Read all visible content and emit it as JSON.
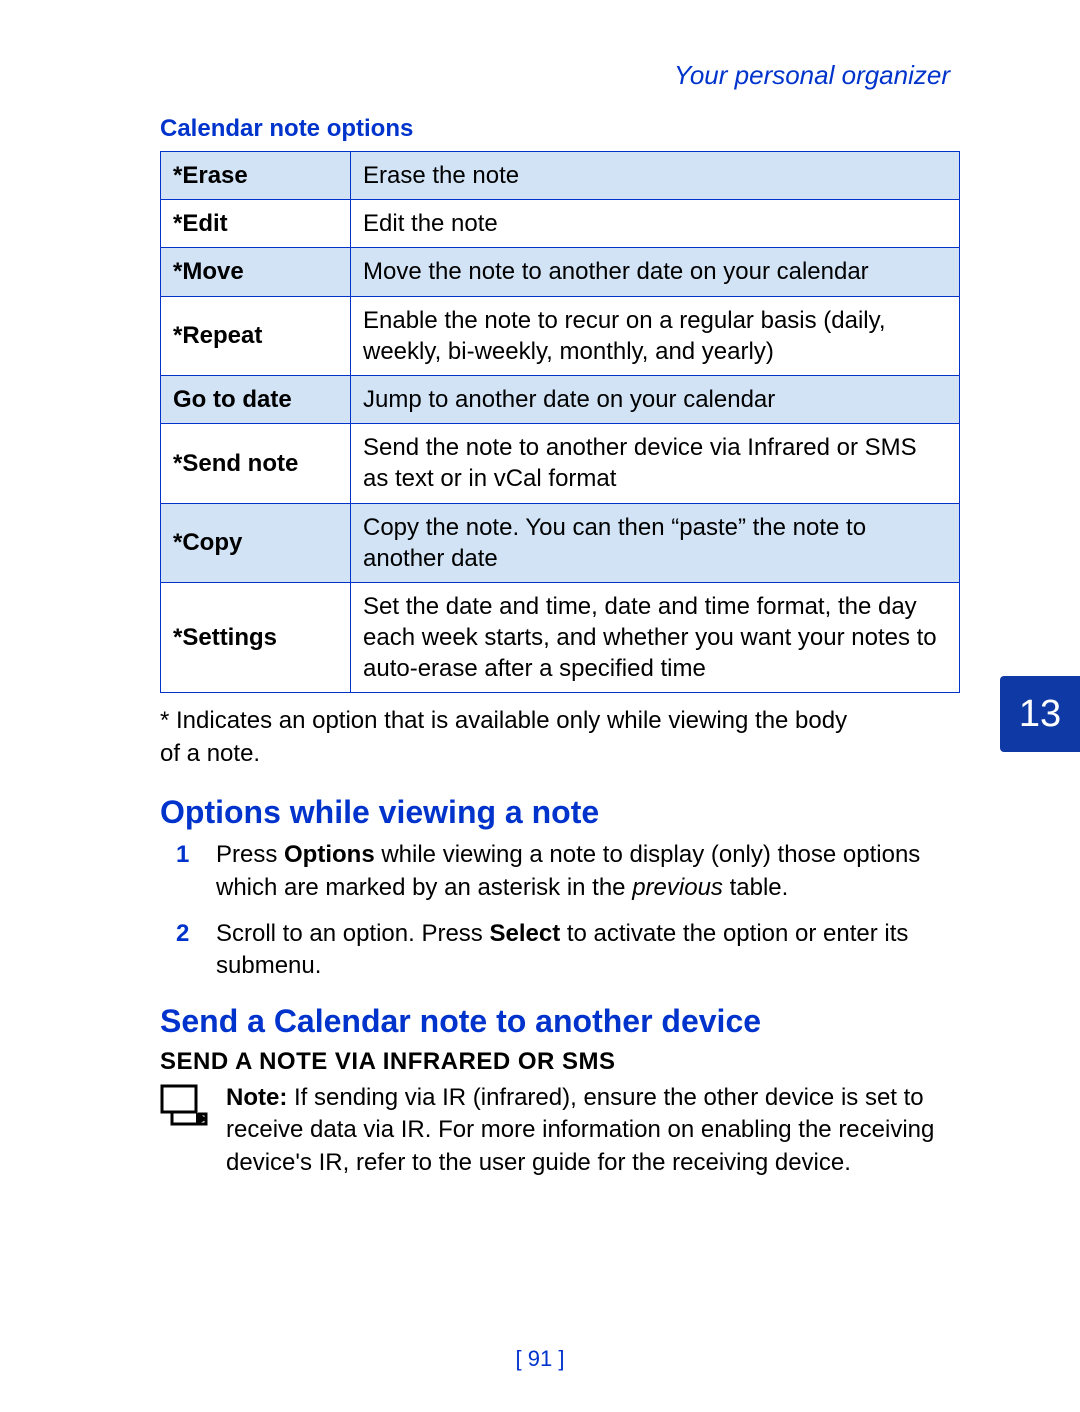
{
  "header": {
    "category": "Your personal organizer"
  },
  "section_caption": "Calendar note options",
  "table": {
    "rows": [
      {
        "option": "*Erase",
        "desc": "Erase the note",
        "shaded": true
      },
      {
        "option": "*Edit",
        "desc": "Edit the note",
        "shaded": false
      },
      {
        "option": "*Move",
        "desc": "Move the note to another date on your calendar",
        "shaded": true
      },
      {
        "option": "*Repeat",
        "desc": "Enable the note to recur on a regular basis (daily, weekly, bi-weekly, monthly, and yearly)",
        "shaded": false
      },
      {
        "option": "Go to date",
        "desc": "Jump to another date on your calendar",
        "shaded": true
      },
      {
        "option": "*Send note",
        "desc": "Send the note to another device via Infrared or SMS as text or in vCal format",
        "shaded": false
      },
      {
        "option": "*Copy",
        "desc": "Copy the note. You can then “paste” the note to another date",
        "shaded": true
      },
      {
        "option": "*Settings",
        "desc": "Set the date and time, date and time format, the day each week starts, and whether you want your notes to auto-erase after a specified time",
        "shaded": false
      }
    ]
  },
  "footnote": "* Indicates an option that is available only while viewing the body of a note.",
  "heading_a": "Options while viewing a note",
  "steps": {
    "s1_a": "Press ",
    "s1_b": "Options",
    "s1_c": " while viewing a note to display (only) those options which are marked by an asterisk in the ",
    "s1_d": "previous",
    "s1_e": " table.",
    "s2_a": "Scroll to an option. Press ",
    "s2_b": "Select",
    "s2_c": " to activate the option or enter its submenu."
  },
  "heading_b": "Send a Calendar note to another device",
  "subheading": "SEND A NOTE VIA INFRARED OR SMS",
  "note": {
    "label": "Note:",
    "body": " If sending via IR (infrared), ensure the other device is set to receive data via IR. For more information on enabling the receiving device's IR, refer to the user guide for the receiving device."
  },
  "chapter": "13",
  "page_number": "[ 91 ]"
}
